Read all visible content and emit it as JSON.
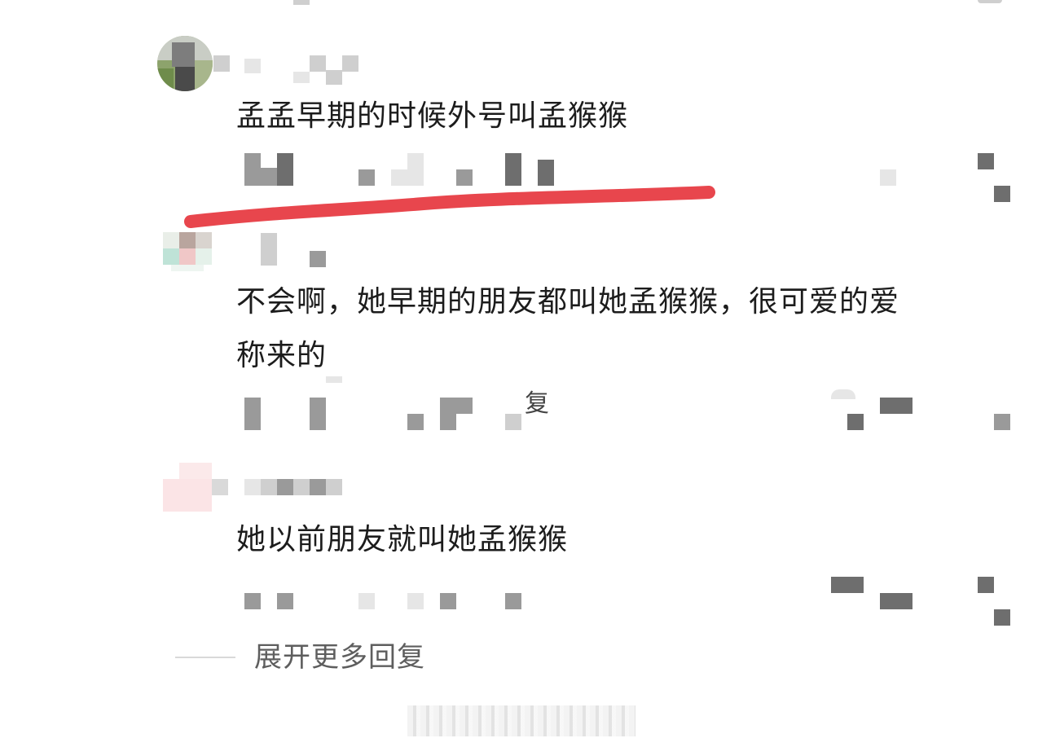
{
  "comments": [
    {
      "text": "孟孟早期的时候外号叫孟猴猴"
    },
    {
      "text": "不会啊，她早期的朋友都叫她孟猴猴，很可爱的爱\n称来的",
      "reply_fragment": "复"
    },
    {
      "text": "她以前朋友就叫她孟猴猴"
    }
  ],
  "expand_more": {
    "label": "展开更多回复"
  },
  "colors": {
    "underline_mark": "#e8464d",
    "text": "#1c1c1c",
    "secondary_text": "#5e5e5e",
    "mosaic": "#9a9a9a"
  },
  "icons": {
    "avatar_1": "avatar-photo",
    "avatar_2": "avatar-photo",
    "avatar_3": "avatar-photo"
  }
}
